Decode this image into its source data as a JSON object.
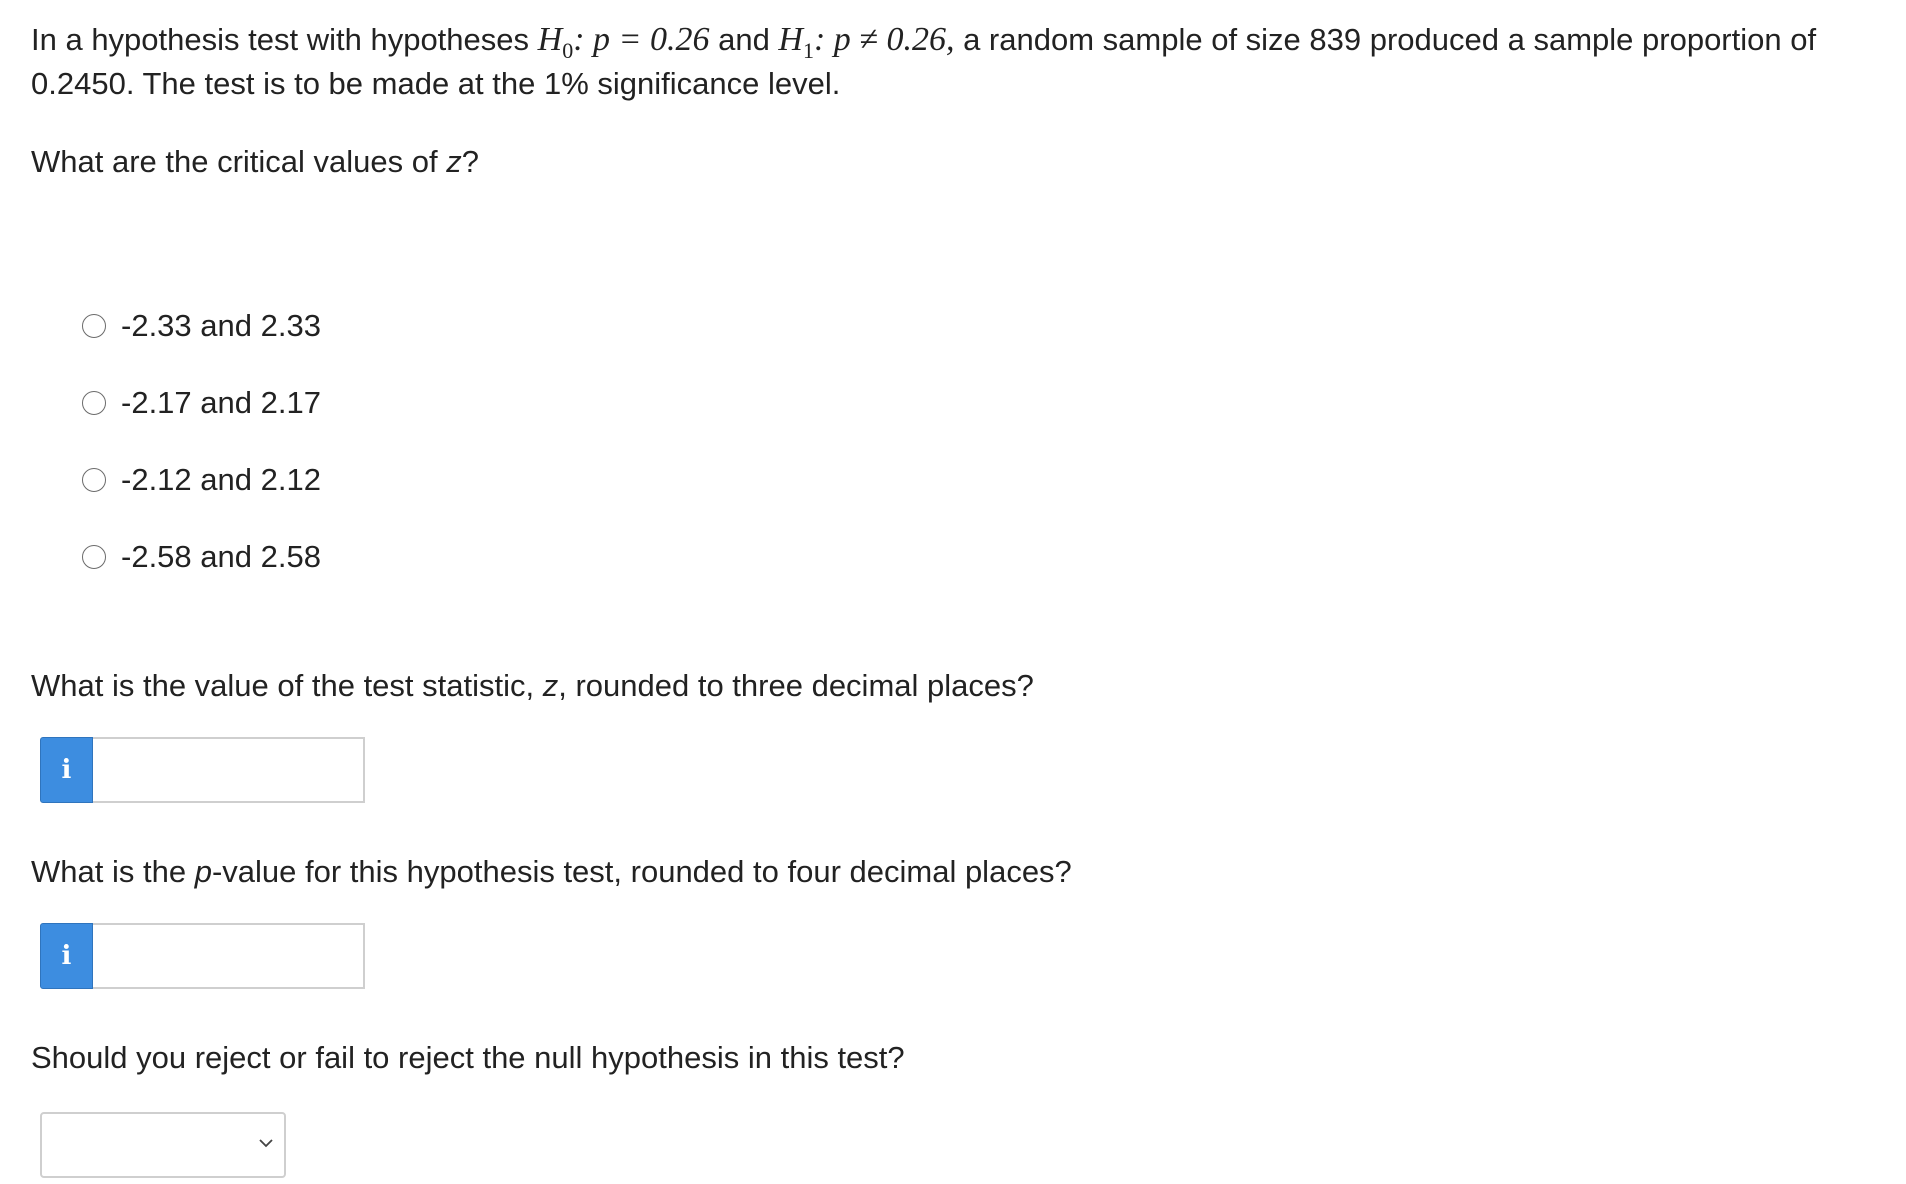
{
  "question": {
    "intro_prefix": "In a hypothesis test with hypotheses ",
    "h0_symbol": "H",
    "h0_sub": "0",
    "h0_expr": ": p = 0.26",
    "and_text": " and ",
    "h1_symbol": "H",
    "h1_sub": "1",
    "h1_expr": ": p ≠ 0.26,",
    "intro_suffix": " a random sample of size 839 produced a sample proportion of 0.2450. The test is to be made at the 1% significance level."
  },
  "part1": {
    "prompt_before": "What are the critical values of ",
    "prompt_var": "z",
    "prompt_after": "?",
    "options": [
      {
        "label": "-2.33 and 2.33",
        "selected": false
      },
      {
        "label": "-2.17 and 2.17",
        "selected": false
      },
      {
        "label": "-2.12 and 2.12",
        "selected": false
      },
      {
        "label": "-2.58 and 2.58",
        "selected": false
      }
    ]
  },
  "part2": {
    "prompt_before": "What is the value of the test statistic, ",
    "prompt_var": "z",
    "prompt_after": ", rounded to three decimal places?",
    "info_icon": "i",
    "input_value": ""
  },
  "part3": {
    "prompt_before": "What is the ",
    "prompt_var": "p",
    "prompt_after": "-value for this hypothesis test, rounded to four decimal places?",
    "info_icon": "i",
    "input_value": ""
  },
  "part4": {
    "prompt": "Should you reject or fail to reject the null hypothesis in this test?",
    "selected_value": ""
  },
  "colors": {
    "info_button": "#3d8de0",
    "text": "#222222",
    "input_border": "#cfcfcf"
  }
}
